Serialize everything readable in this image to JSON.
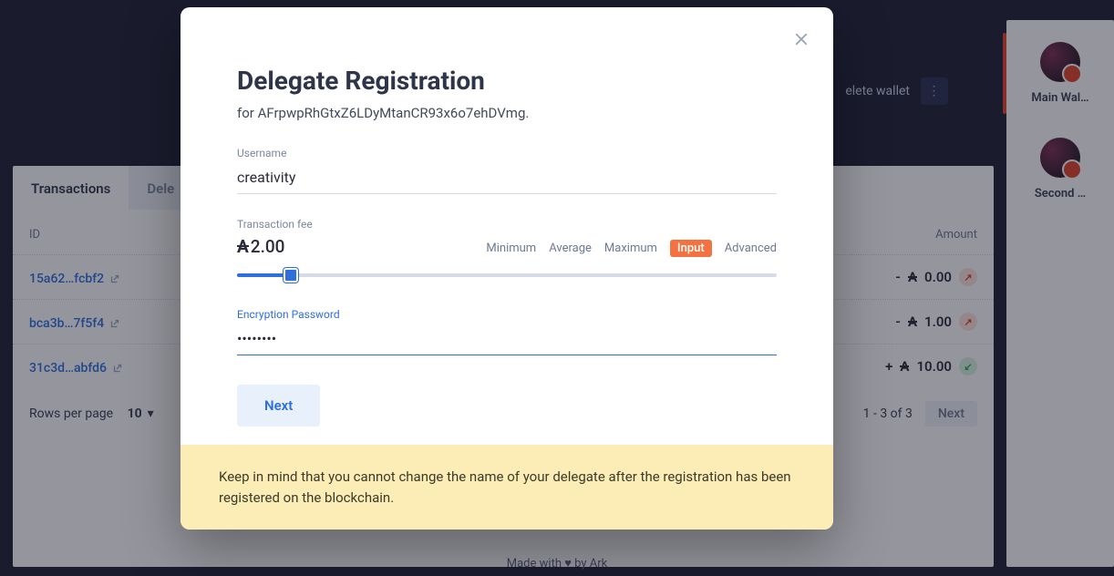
{
  "topbar": {
    "delete_wallet": "elete wallet"
  },
  "tabs": {
    "transactions": "Transactions",
    "delegate_partial": "Dele"
  },
  "table": {
    "col_id": "ID",
    "col_amount": "Amount",
    "rows": [
      {
        "id": "15a62…fcbf2",
        "amount": "0.00",
        "sign": "-",
        "dir": "out"
      },
      {
        "id": "bca3b…7f5f4",
        "amount": "1.00",
        "sign": "-",
        "dir": "out"
      },
      {
        "id": "31c3d…abfd6",
        "amount": "10.00",
        "sign": "+",
        "dir": "in"
      }
    ]
  },
  "pager": {
    "rows_label": "Rows per page",
    "rows_value": "10",
    "range": "1 - 3 of 3",
    "next": "Next"
  },
  "wallets": [
    {
      "label": "Main Wal…",
      "active": true
    },
    {
      "label": "Second …",
      "active": false
    }
  ],
  "footer": "Made with ♥ by Ark",
  "modal": {
    "title": "Delegate Registration",
    "subtitle": "for AFrpwpRhGtxZ6LDyMtanCR93x6o7ehDVmg.",
    "username_label": "Username",
    "username_value": "creativity",
    "fee_label": "Transaction fee",
    "fee_value": "2.00",
    "fee_opts": {
      "minimum": "Minimum",
      "average": "Average",
      "maximum": "Maximum",
      "input": "Input",
      "advanced": "Advanced"
    },
    "password_label": "Encryption Password",
    "password_value": "••••••••",
    "next": "Next",
    "warning": "Keep in mind that you cannot change the name of your delegate after the registration has been registered on the blockchain."
  }
}
